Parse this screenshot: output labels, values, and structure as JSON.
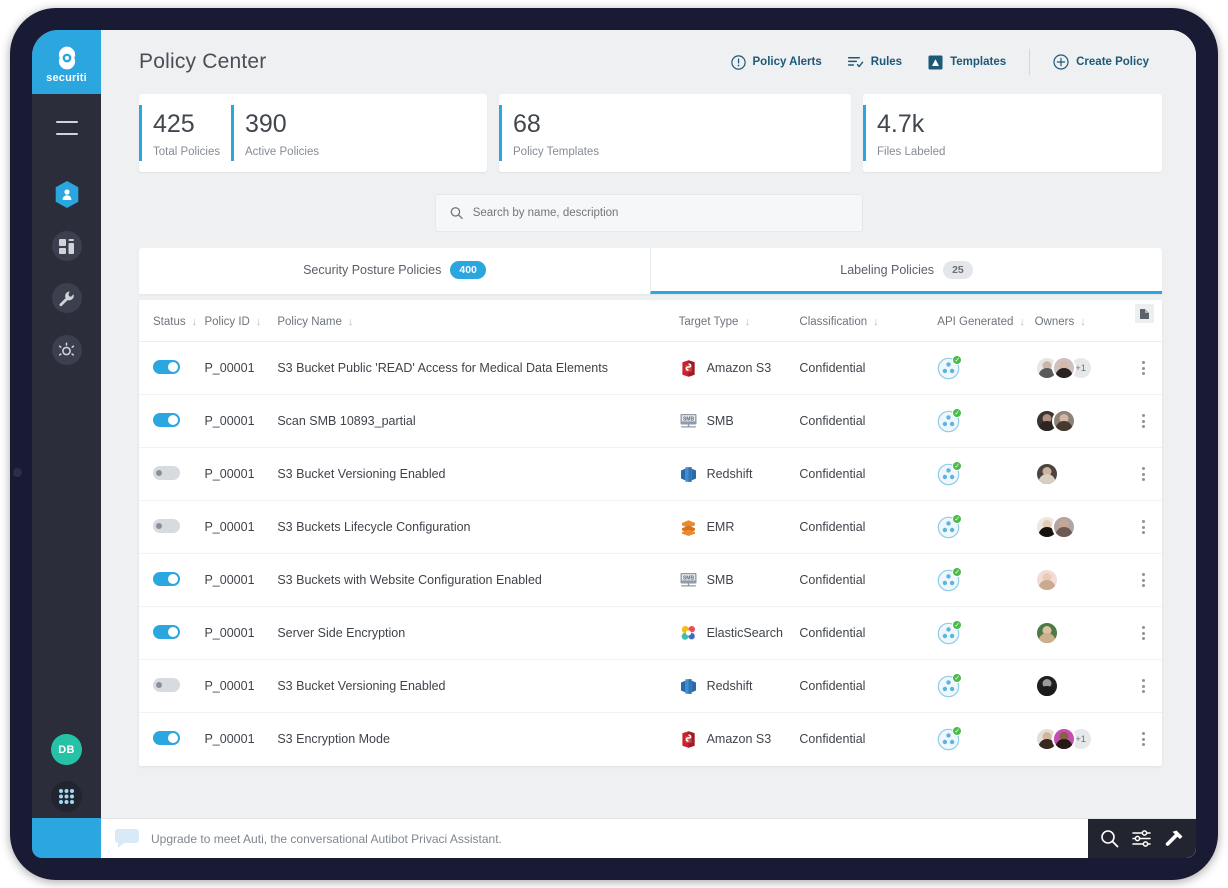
{
  "brand": {
    "name": "securiti",
    "logo_icon": "securiti-logo-icon",
    "accent": "#2ba6de"
  },
  "sidebar": {
    "menu_icon": "hamburger-menu-icon",
    "items": [
      {
        "icon": "hexagon-privacy-icon",
        "name": "sidebar-item-privacy"
      },
      {
        "icon": "dashboard-icon",
        "name": "sidebar-item-dashboard"
      },
      {
        "icon": "wrench-icon",
        "name": "sidebar-item-tools"
      },
      {
        "icon": "gear-settings-icon",
        "name": "sidebar-item-settings"
      }
    ],
    "user_initials": "DB",
    "apps_icon": "apps-grid-icon"
  },
  "header": {
    "title": "Policy Center",
    "actions": [
      {
        "label": "Policy Alerts",
        "icon": "alert-circle-icon"
      },
      {
        "label": "Rules",
        "icon": "rules-list-icon"
      },
      {
        "label": "Templates",
        "icon": "templates-icon"
      },
      {
        "label": "Create Policy",
        "icon": "plus-circle-icon"
      }
    ]
  },
  "stats": [
    {
      "value": "425",
      "label": "Total Policies"
    },
    {
      "value": "390",
      "label": "Active Policies"
    },
    {
      "value": "68",
      "label": "Policy Templates"
    },
    {
      "value": "4.7k",
      "label": "Files Labeled"
    }
  ],
  "search": {
    "placeholder": "Search by name, description",
    "value": "",
    "icon": "search-icon"
  },
  "tabs": [
    {
      "label": "Security Posture Policies",
      "count": "400",
      "active": false,
      "badge_style": "blue"
    },
    {
      "label": "Labeling Policies",
      "count": "25",
      "active": true,
      "badge_style": "grey"
    }
  ],
  "table": {
    "export_icon": "export-document-icon",
    "columns": [
      {
        "label": "Status",
        "sortable": true
      },
      {
        "label": "Policy ID",
        "sortable": true
      },
      {
        "label": "Policy Name",
        "sortable": true
      },
      {
        "label": "Target Type",
        "sortable": true
      },
      {
        "label": "Classification",
        "sortable": true
      },
      {
        "label": "API Generated",
        "sortable": true
      },
      {
        "label": "Owners",
        "sortable": true
      }
    ],
    "sort_arrow": "↓",
    "rows": [
      {
        "status": "on",
        "policy_id": "P_00001",
        "policy_name": "S3 Bucket Public 'READ' Access for Medical Data Elements",
        "target_type": "Amazon S3",
        "target_icon": "amazon-s3-icon",
        "classification": "Confidential",
        "api_generated": true,
        "owners": [
          {
            "skin": "#c9b7ad",
            "hair": "#5a5a5a",
            "bg": "#e8e6e3"
          },
          {
            "skin": "#d8b9a6",
            "hair": "#2a2320",
            "bg": "#cdbfc2"
          }
        ],
        "owners_more": "+1"
      },
      {
        "status": "on",
        "policy_id": "P_00001",
        "policy_name": "Scan SMB 10893_partial",
        "target_type": "SMB",
        "target_icon": "smb-icon",
        "classification": "Confidential",
        "api_generated": true,
        "owners": [
          {
            "skin": "#b09080",
            "hair": "#2d2520",
            "bg": "#3a3330"
          },
          {
            "skin": "#d3b6a4",
            "hair": "#46392f",
            "bg": "#8d8279"
          }
        ],
        "owners_more": ""
      },
      {
        "status": "off",
        "policy_id": "P_00001",
        "policy_name": "S3 Bucket Versioning Enabled",
        "target_type": "Redshift",
        "target_icon": "redshift-icon",
        "classification": "Confidential",
        "api_generated": true,
        "owners": [
          {
            "skin": "#cdb39c",
            "hair": "#d8cec2",
            "bg": "#4b443f"
          }
        ],
        "owners_more": ""
      },
      {
        "status": "off",
        "policy_id": "P_00001",
        "policy_name": "S3 Buckets Lifecycle Configuration",
        "target_type": "EMR",
        "target_icon": "emr-icon",
        "classification": "Confidential",
        "api_generated": true,
        "owners": [
          {
            "skin": "#e3cbb8",
            "hair": "#17120f",
            "bg": "#efe6e0"
          },
          {
            "skin": "#c8a895",
            "hair": "#6d5a52",
            "bg": "#b3a4a6"
          }
        ],
        "owners_more": ""
      },
      {
        "status": "on",
        "policy_id": "P_00001",
        "policy_name": "S3 Buckets with Website Configuration Enabled",
        "target_type": "SMB",
        "target_icon": "smb-icon",
        "classification": "Confidential",
        "api_generated": true,
        "owners": [
          {
            "skin": "#e9cbb5",
            "hair": "#caa98e",
            "bg": "#f3dcd6"
          }
        ],
        "owners_more": ""
      },
      {
        "status": "on",
        "policy_id": "P_00001",
        "policy_name": "Server Side Encryption",
        "target_type": "ElasticSearch",
        "target_icon": "elasticsearch-icon",
        "classification": "Confidential",
        "api_generated": true,
        "owners": [
          {
            "skin": "#e0c0a4",
            "hair": "#ccb089",
            "bg": "#4e7a46"
          }
        ],
        "owners_more": ""
      },
      {
        "status": "off",
        "policy_id": "P_00001",
        "policy_name": "S3 Bucket Versioning Enabled",
        "target_type": "Redshift",
        "target_icon": "redshift-icon",
        "classification": "Confidential",
        "api_generated": true,
        "owners": [
          {
            "skin": "#9a9a9a",
            "hair": "#1a1a1a",
            "bg": "#1f1f1f"
          }
        ],
        "owners_more": ""
      },
      {
        "status": "on",
        "policy_id": "P_00001",
        "policy_name": "S3 Encryption Mode",
        "target_type": "Amazon S3",
        "target_icon": "amazon-s3-icon",
        "classification": "Confidential",
        "api_generated": true,
        "owners": [
          {
            "skin": "#d6b49c",
            "hair": "#38281f",
            "bg": "#e4ded6"
          },
          {
            "skin": "#8a5f46",
            "hair": "#241a14",
            "bg": "#c44fb0"
          }
        ],
        "owners_more": "+1"
      }
    ]
  },
  "bottom_bar": {
    "message": "Upgrade to meet Auti, the conversational Autibot Privaci Assistant.",
    "chat_icon": "chat-bubble-icon",
    "tools": [
      {
        "icon": "search-icon",
        "name": "bottom-search-icon"
      },
      {
        "icon": "sliders-icon",
        "name": "bottom-filters-icon"
      },
      {
        "icon": "hammer-icon",
        "name": "bottom-build-icon"
      }
    ]
  }
}
